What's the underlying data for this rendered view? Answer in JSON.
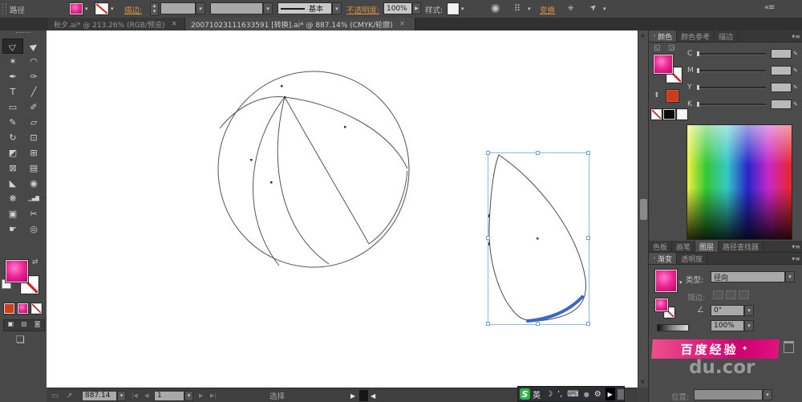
{
  "colors": {
    "accent_magenta": "#ee2a96",
    "selection_blue": "#6fa3d8",
    "link_orange": "#d8913f",
    "sogou_green": "#2db44d"
  },
  "topbar": {
    "panel_label": "路径",
    "stroke_link": "描边:",
    "brush_style": "基本",
    "opacity_link": "不透明度:",
    "opacity_value": "100%",
    "style_label": "样式:",
    "transform_link": "变换",
    "icons": {
      "recolor": "◉",
      "align_grid": "⠿",
      "target": "⌖",
      "cursor": "➤",
      "collapse": "«≡"
    }
  },
  "document_tabs": [
    {
      "label": "秋夕.ai* @ 213.26% (RGB/预览)",
      "close": "×",
      "active": false
    },
    {
      "label": "20071023111633591 [转换].ai* @ 887.14% (CMYK/轮廓)",
      "close": "×",
      "active": true
    }
  ],
  "toolbar": {
    "tools": [
      {
        "name": "direct-selection-tool",
        "glyph": "▷",
        "selected": true
      },
      {
        "name": "selection-tool",
        "glyph": "▶"
      },
      {
        "name": "magic-wand-tool",
        "glyph": "✶"
      },
      {
        "name": "lasso-tool",
        "glyph": "◠"
      },
      {
        "name": "pen-tool",
        "glyph": "✒"
      },
      {
        "name": "curvature-pen-tool",
        "glyph": "✑"
      },
      {
        "name": "type-tool",
        "glyph": "T"
      },
      {
        "name": "line-segment-tool",
        "glyph": "╱"
      },
      {
        "name": "rectangle-tool",
        "glyph": "▭"
      },
      {
        "name": "paintbrush-tool",
        "glyph": "✐"
      },
      {
        "name": "pencil-tool",
        "glyph": "✎"
      },
      {
        "name": "eraser-tool",
        "glyph": "▱"
      },
      {
        "name": "rotate-tool",
        "glyph": "↻"
      },
      {
        "name": "free-transform-tool",
        "glyph": "⊡"
      },
      {
        "name": "shape-builder-tool",
        "glyph": "◩"
      },
      {
        "name": "perspective-grid-tool",
        "glyph": "⊞"
      },
      {
        "name": "mesh-tool",
        "glyph": "⊠"
      },
      {
        "name": "gradient-tool",
        "glyph": "▤"
      },
      {
        "name": "eyedropper-tool",
        "glyph": "◣"
      },
      {
        "name": "blend-tool",
        "glyph": "◉"
      },
      {
        "name": "symbol-sprayer-tool",
        "glyph": "❋"
      },
      {
        "name": "column-graph-tool",
        "glyph": "▁▄▇"
      },
      {
        "name": "artboard-tool",
        "glyph": "▣"
      },
      {
        "name": "slice-tool",
        "glyph": "✂"
      },
      {
        "name": "hand-tool",
        "glyph": "☛"
      },
      {
        "name": "zoom-tool",
        "glyph": "◎"
      }
    ]
  },
  "right_panel": {
    "tabs_color": [
      {
        "label": "颜色",
        "active": true
      },
      {
        "label": "颜色参考",
        "active": false
      },
      {
        "label": "描边",
        "active": false
      }
    ],
    "color": {
      "channels": [
        {
          "label": "C"
        },
        {
          "label": "M"
        },
        {
          "label": "Y"
        },
        {
          "label": "K"
        }
      ]
    },
    "tabs_mid": [
      {
        "label": "色板",
        "active": false
      },
      {
        "label": "画笔",
        "active": false
      },
      {
        "label": "图层",
        "active": true
      },
      {
        "label": "路径查找器",
        "active": false
      }
    ],
    "tabs_gradient": [
      {
        "label": "渐变",
        "active": true
      },
      {
        "label": "透明度",
        "active": false
      }
    ],
    "gradient": {
      "type_label": "类型:",
      "type_value": "径向",
      "stroke_label": "描边:",
      "angle_icon": "∠",
      "angle_value": "0°",
      "aspect_value": "100%",
      "position_label": "位置:"
    },
    "watermark": {
      "banner": "百度经验",
      "star": "✦",
      "text": "du.cor"
    }
  },
  "status_bar": {
    "zoom_value": "887.14",
    "artboard_value": "1",
    "status_text": "选择"
  },
  "ime": {
    "logo": "S",
    "mode": "英",
    "expand": "▶",
    "icons": [
      {
        "name": "moon-icon",
        "glyph": "☽"
      },
      {
        "name": "punctuation-icon",
        "glyph": "’,"
      },
      {
        "name": "keyboard-icon",
        "glyph": "⌨"
      },
      {
        "name": "skin-icon",
        "glyph": "●"
      },
      {
        "name": "toolbox-icon",
        "glyph": "⚙"
      }
    ]
  },
  "ui": {
    "dropdown": "▾",
    "spin_up": "▴",
    "spin_down": "▾",
    "left": "◀",
    "right": "▶",
    "first": "|◀",
    "last": "▶|",
    "menu": "▾≡",
    "pages": "▭",
    "export": "↗",
    "nib": "✎"
  }
}
